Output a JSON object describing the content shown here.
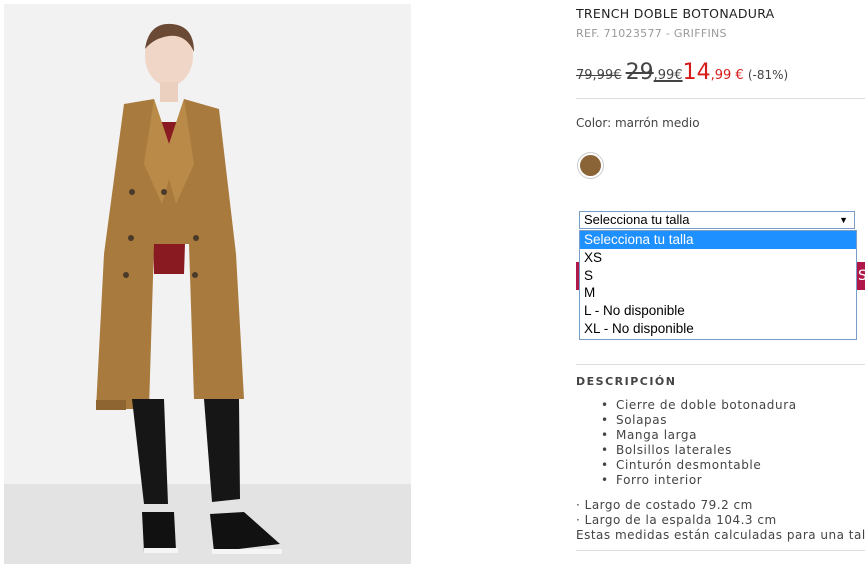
{
  "product": {
    "title": "TRENCH DOBLE BOTONADURA",
    "ref": "REF. 71023577 - GRIFFINS",
    "price_original": "79,99€",
    "price_previous_int": "29",
    "price_previous_dec": ",99€",
    "price_current_int": "14",
    "price_current_dec": ",99 €",
    "discount": "(-81%)",
    "color_label": "Color: marrón medio",
    "swatch_color": "#8a6437"
  },
  "size_select": {
    "selected": "Selecciona tu talla",
    "options": [
      "Selecciona tu talla",
      "XS",
      "S",
      "M",
      "L - No disponible",
      "XL - No disponible"
    ],
    "button_partial": "S"
  },
  "description": {
    "heading": "DESCRIPCIÓN",
    "items": [
      "Cierre de doble botonadura",
      "Solapas",
      "Manga larga",
      "Bolsillos laterales",
      "Cinturón desmontable",
      "Forro interior"
    ],
    "measures": [
      "· Largo de costado 79.2 cm",
      "· Largo de la espalda 104.3 cm",
      "Estas medidas están calculadas para una talla"
    ]
  },
  "colors": {
    "accent_red": "#d61a1a",
    "button": "#b0184a",
    "highlight": "#1e90ff"
  }
}
